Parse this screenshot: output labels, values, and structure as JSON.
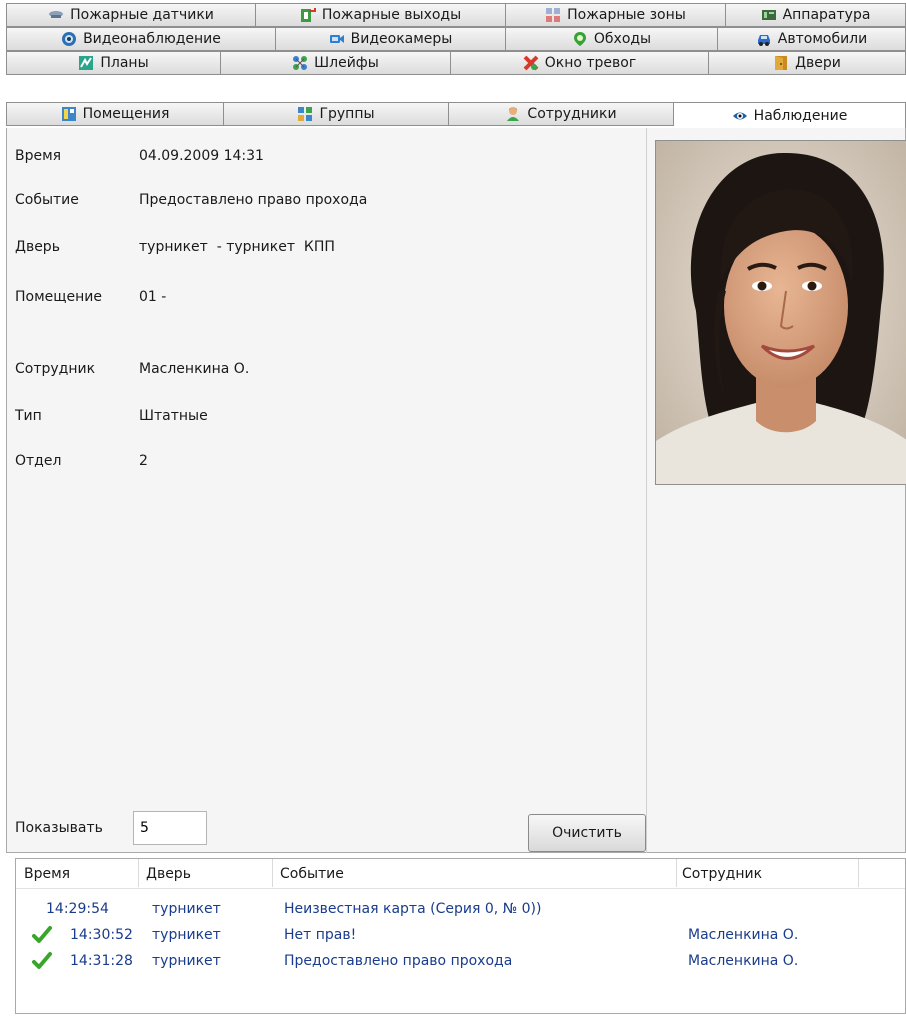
{
  "tabs": {
    "row1": [
      {
        "label": "Пожарные датчики",
        "icon": "smoke-detector-icon"
      },
      {
        "label": "Пожарные выходы",
        "icon": "fire-exit-icon"
      },
      {
        "label": "Пожарные зоны",
        "icon": "fire-zone-icon"
      },
      {
        "label": "Аппаратура",
        "icon": "hardware-icon"
      }
    ],
    "row2": [
      {
        "label": "Видеонаблюдение",
        "icon": "video-surveillance-icon"
      },
      {
        "label": "Видеокамеры",
        "icon": "video-camera-icon"
      },
      {
        "label": "Обходы",
        "icon": "patrol-icon"
      },
      {
        "label": "Автомобили",
        "icon": "car-icon"
      }
    ],
    "row3": [
      {
        "label": "Планы",
        "icon": "plans-icon"
      },
      {
        "label": "Шлейфы",
        "icon": "loops-icon"
      },
      {
        "label": "Окно тревог",
        "icon": "alarm-window-icon"
      },
      {
        "label": "Двери",
        "icon": "door-icon"
      }
    ],
    "row4": [
      {
        "label": "Помещения",
        "icon": "rooms-icon"
      },
      {
        "label": "Группы",
        "icon": "groups-icon"
      },
      {
        "label": "Сотрудники",
        "icon": "employees-icon"
      },
      {
        "label": "Наблюдение",
        "icon": "eye-icon",
        "active": true
      }
    ]
  },
  "details": {
    "time_label": "Время",
    "time_value": "04.09.2009 14:31",
    "event_label": "Событие",
    "event_value": "Предоставлено право прохода",
    "door_label": "Дверь",
    "door_value": "турникет  - турникет  КПП",
    "room_label": "Помещение",
    "room_value": "01 -",
    "employee_label": "Сотрудник",
    "employee_value": "Масленкина О.",
    "type_label": "Тип",
    "type_value": "Штатные",
    "dept_label": "Отдел",
    "dept_value": "2"
  },
  "controls": {
    "show_label": "Показывать",
    "show_value": "5",
    "clear_label": "Очистить"
  },
  "events": {
    "columns": [
      "Время",
      "Дверь",
      "Событие",
      "Сотрудник"
    ],
    "rows": [
      {
        "time": "14:29:54",
        "door": "турникет",
        "event": "Неизвестная карта (Серия 0, № 0))",
        "employee": "",
        "ok": false
      },
      {
        "time": "14:30:52",
        "door": "турникет",
        "event": "Нет прав!",
        "employee": "Масленкина О.",
        "ok": true
      },
      {
        "time": "14:31:28",
        "door": "турникет",
        "event": "Предоставлено право прохода",
        "employee": "Масленкина О.",
        "ok": true
      }
    ]
  },
  "colors": {
    "check_green": "#3aa52b",
    "event_text": "#1a3c8c"
  }
}
